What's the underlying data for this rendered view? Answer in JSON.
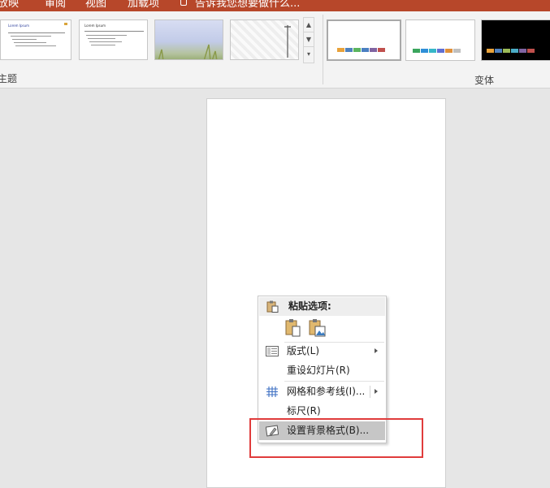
{
  "ribbon_tabs": [
    "放映",
    "审阅",
    "视图",
    "加载项",
    "告诉我您想要做什么..."
  ],
  "ribbon": {
    "themes_group_label": "主题",
    "variants_group_label": "变体",
    "theme_thumbnails": [
      {
        "title": "Lorem Ipsum"
      },
      {
        "title": "Lorem Ipsum"
      },
      {
        "title": ""
      },
      {
        "title": ""
      }
    ],
    "variants": [
      {
        "background": "#ffffff",
        "swatches": [
          "#e8a23a",
          "#4f81bd",
          "#5bb45e",
          "#4a7fc1",
          "#8064a2",
          "#c0504d"
        ]
      },
      {
        "background": "#ffffff",
        "swatches": [
          "#3aa55d",
          "#2f8fd8",
          "#36b7c8",
          "#5f6fd4",
          "#e0903a",
          "#c0c0c0"
        ]
      },
      {
        "background": "#000000",
        "swatches": [
          "#e8a23a",
          "#4f81bd",
          "#9bbb59",
          "#4bacc6",
          "#8064a2",
          "#c0504d"
        ]
      }
    ]
  },
  "context_menu": {
    "paste_header": "粘贴选项:",
    "items": [
      {
        "label": "版式(L)",
        "has_submenu": true
      },
      {
        "label": "重设幻灯片(R)",
        "has_submenu": false
      },
      {
        "label": "网格和参考线(I)...",
        "has_submenu": true
      },
      {
        "label": "标尺(R)",
        "has_submenu": false
      },
      {
        "label": "设置背景格式(B)...",
        "has_submenu": false,
        "highlighted": true
      }
    ]
  },
  "colors": {
    "accent": "#b7472a",
    "highlight_box": "#e03c3c"
  }
}
